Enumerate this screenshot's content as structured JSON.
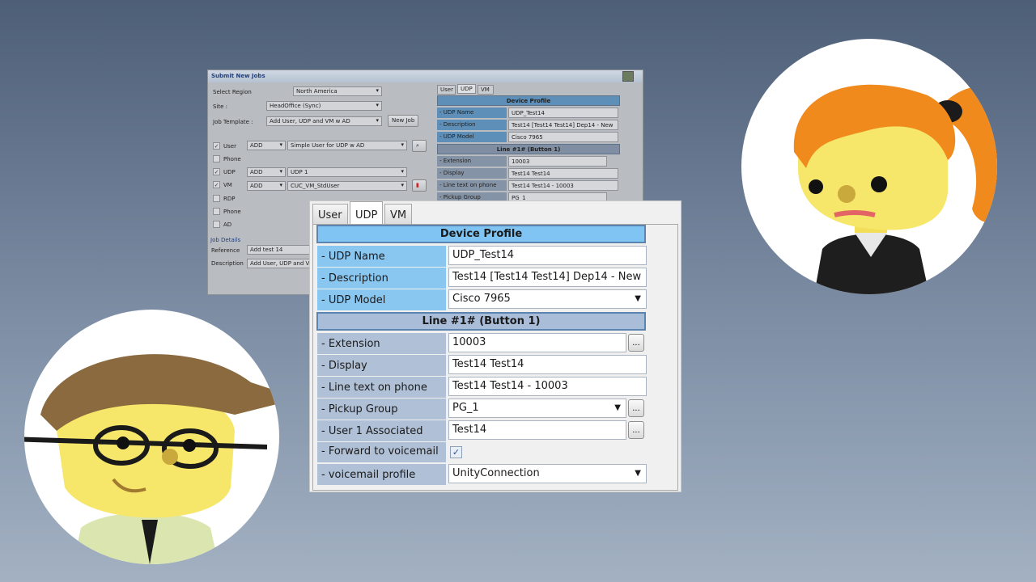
{
  "back_window": {
    "title": "Submit New Jobs",
    "region_label": "Select Region",
    "region_value": "North America",
    "site_label": "Site :",
    "site_value": "HeadOffice (Sync)",
    "template_label": "Job Template :",
    "template_value": "Add User, UDP and VM w AD",
    "new_job_label": "New Job",
    "items": [
      {
        "label": "User",
        "checked": true,
        "action": "ADD",
        "value": "Simple User for UDP w AD"
      },
      {
        "label": "Phone",
        "checked": false
      },
      {
        "label": "UDP",
        "checked": true,
        "action": "ADD",
        "value": "UDP 1"
      },
      {
        "label": "VM",
        "checked": true,
        "action": "ADD",
        "value": "CUC_VM_StdUser"
      },
      {
        "label": "RDP",
        "checked": false
      },
      {
        "label": "Phone",
        "checked": false
      },
      {
        "label": "AD",
        "checked": false
      }
    ],
    "job_details_label": "Job Details",
    "reference_label": "Reference",
    "reference_value": "Add test 14",
    "description_label": "Description",
    "description_value": "Add User, UDP and VM",
    "tabs": [
      "User",
      "UDP",
      "VM"
    ],
    "device_profile": "Device Profile",
    "line_header": "Line #1#  (Button 1)",
    "rows": [
      {
        "label": "- UDP Name",
        "value": "UDP_Test14"
      },
      {
        "label": "- Description",
        "value": "Test14 [Test14 Test14] Dep14 - New"
      },
      {
        "label": "- UDP Model",
        "value": "Cisco 7965"
      },
      {
        "label": "- Extension",
        "value": "10003"
      },
      {
        "label": "- Display",
        "value": "Test14 Test14"
      },
      {
        "label": "- Line text on phone",
        "value": "Test14 Test14 - 10003"
      },
      {
        "label": "- Pickup Group",
        "value": "PG_1"
      }
    ]
  },
  "front_panel": {
    "tabs": [
      "User",
      "UDP",
      "VM"
    ],
    "active_tab": "UDP",
    "device_profile": "Device Profile",
    "line_header": "Line #1#  (Button 1)",
    "udp_name": {
      "label": "- UDP Name",
      "value": "UDP_Test14"
    },
    "description": {
      "label": "- Description",
      "value": "Test14 [Test14 Test14] Dep14 - New"
    },
    "udp_model": {
      "label": "- UDP Model",
      "value": "Cisco 7965"
    },
    "extension": {
      "label": "- Extension",
      "value": "10003"
    },
    "display": {
      "label": "- Display",
      "value": "Test14 Test14"
    },
    "line_text": {
      "label": "- Line text on phone",
      "value": "Test14 Test14 - 10003"
    },
    "pickup_group": {
      "label": "- Pickup Group",
      "value": "PG_1"
    },
    "user_associated": {
      "label": "- User 1 Associated",
      "value": "Test14"
    },
    "forward_voicemail": {
      "label": "- Forward to voicemail",
      "checked": true
    },
    "voicemail_profile": {
      "label": "- voicemail profile",
      "value": "UnityConnection"
    },
    "browse_label": "..."
  },
  "colors": {
    "blue_header": "#7fc4f3",
    "blue_label": "#89c6f0",
    "grey_header": "#a9bcd8",
    "grey_label": "#b0c0d6"
  }
}
